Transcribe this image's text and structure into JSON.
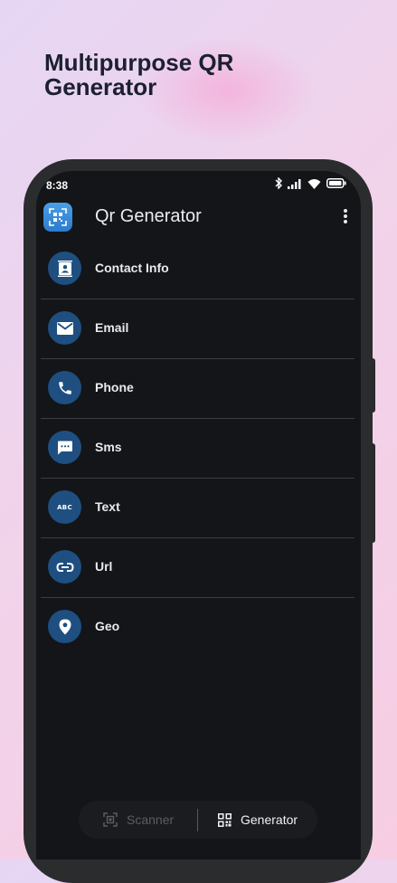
{
  "promo": {
    "headline": "Multipurpose QR Generator"
  },
  "status_bar": {
    "time": "8:38"
  },
  "app": {
    "title": "Qr Generator"
  },
  "menu": [
    {
      "label": "Contact Info",
      "icon": "contact-card-icon"
    },
    {
      "label": "Email",
      "icon": "envelope-icon"
    },
    {
      "label": "Phone",
      "icon": "phone-icon"
    },
    {
      "label": "Sms",
      "icon": "sms-icon"
    },
    {
      "label": "Text",
      "icon": "abc-text-icon"
    },
    {
      "label": "Url",
      "icon": "link-icon"
    },
    {
      "label": "Geo",
      "icon": "location-pin-icon"
    }
  ],
  "bottom_nav": {
    "scanner": "Scanner",
    "generator": "Generator",
    "active": "Generator"
  },
  "colors": {
    "screen_bg": "#131518",
    "icon_circle": "#1e4f80",
    "icon_glyph": "#ffffff",
    "accent": "#2c7bcf"
  }
}
